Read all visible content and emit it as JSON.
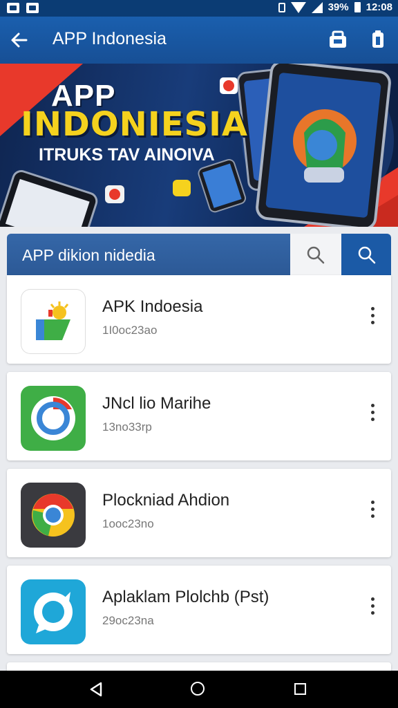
{
  "status_bar": {
    "battery": "39%",
    "time": "12:08",
    "icons": [
      "gallery-icon",
      "photo-icon",
      "vibrate-icon",
      "wifi-icon",
      "signal-icon",
      "battery-icon"
    ]
  },
  "app_bar": {
    "title": "APP Indonesia",
    "icons": [
      "back-arrow-icon",
      "store-icon",
      "more-icon"
    ]
  },
  "banner": {
    "line1": "APP",
    "line2": "INDONIESIA",
    "line3": "ITRUKS TAV AINOIVA"
  },
  "search": {
    "value": "APP dikion nidedia",
    "icons": [
      "search-icon",
      "search-icon"
    ]
  },
  "apps": [
    {
      "name": "APK Indoesia",
      "meta": "1I0oc23ao",
      "icon": "apk-indonesia-icon",
      "color": "#ffffff"
    },
    {
      "name": "JNcl lio Marihe",
      "meta": "13no33rp",
      "icon": "chrome-green-icon",
      "color": "#3fae46"
    },
    {
      "name": "Plockniad Ahdion",
      "meta": "1ooc23no",
      "icon": "chrome-dark-icon",
      "color": "#3a3a3f"
    },
    {
      "name": "Aplaklam Plolchb (Pst)",
      "meta": "29oc23na",
      "icon": "chat-bubble-icon",
      "color": "#1fa7d8"
    }
  ],
  "nav_bar": {
    "icons": [
      "nav-back-icon",
      "nav-home-icon",
      "nav-recents-icon"
    ]
  },
  "colors": {
    "status_bar": "#0b3c74",
    "app_bar": "#1a5fae",
    "search_field": "#3567a8",
    "search_button": "#1b5aa6",
    "banner_yellow": "#f5d21e",
    "banner_red": "#e8392b"
  }
}
